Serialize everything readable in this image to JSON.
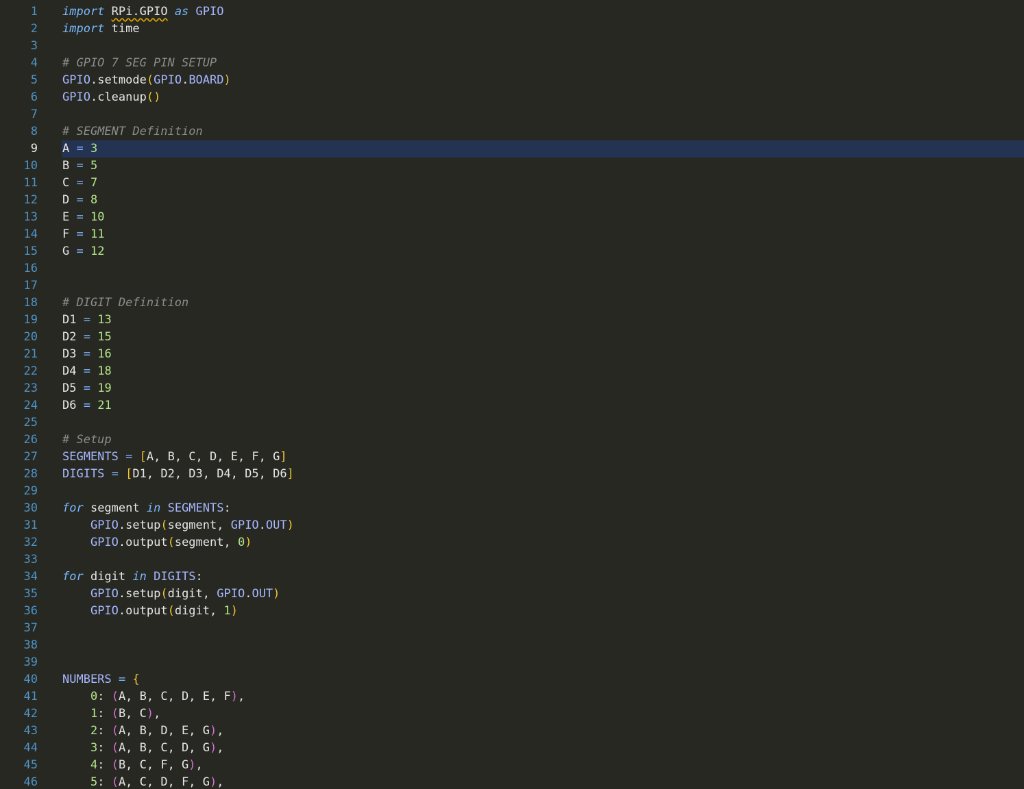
{
  "editor": {
    "language": "python",
    "current_line": 9,
    "colors": {
      "background": "#272822",
      "line_number": "#4e93c7",
      "current_line_highlight": "#243352",
      "keyword": "#79b8ff",
      "identifier": "#e6e6e6",
      "module_name": "#a6b8ff",
      "comment": "#8c8c8c",
      "number": "#b6e68a",
      "bracket": "#f0c832",
      "inner_paren": "#d670d6",
      "warning_squiggle": "#d9a400"
    },
    "lines": [
      {
        "n": "1",
        "tokens": [
          [
            "kw",
            "import"
          ],
          [
            "ident",
            " "
          ],
          [
            "squiggle",
            "RPi.GPIO"
          ],
          [
            "ident",
            " "
          ],
          [
            "kw",
            "as"
          ],
          [
            "ident",
            " "
          ],
          [
            "mod",
            "GPIO"
          ]
        ]
      },
      {
        "n": "2",
        "tokens": [
          [
            "kw",
            "import"
          ],
          [
            "ident",
            " time"
          ]
        ]
      },
      {
        "n": "3",
        "tokens": []
      },
      {
        "n": "4",
        "tokens": [
          [
            "comment",
            "# GPIO 7 SEG PIN SETUP"
          ]
        ]
      },
      {
        "n": "5",
        "tokens": [
          [
            "mod",
            "GPIO"
          ],
          [
            "punc",
            "."
          ],
          [
            "ident",
            "setmode"
          ],
          [
            "paren",
            "("
          ],
          [
            "mod",
            "GPIO"
          ],
          [
            "punc",
            "."
          ],
          [
            "mod",
            "BOARD"
          ],
          [
            "paren",
            ")"
          ]
        ]
      },
      {
        "n": "6",
        "tokens": [
          [
            "mod",
            "GPIO"
          ],
          [
            "punc",
            "."
          ],
          [
            "ident",
            "cleanup"
          ],
          [
            "paren",
            "()"
          ]
        ]
      },
      {
        "n": "7",
        "tokens": []
      },
      {
        "n": "8",
        "tokens": [
          [
            "comment",
            "# SEGMENT Definition"
          ]
        ]
      },
      {
        "n": "9",
        "tokens": [
          [
            "ident",
            "A "
          ],
          [
            "op",
            "="
          ],
          [
            "ident",
            " "
          ],
          [
            "num",
            "3"
          ]
        ]
      },
      {
        "n": "10",
        "tokens": [
          [
            "ident",
            "B "
          ],
          [
            "op",
            "="
          ],
          [
            "ident",
            " "
          ],
          [
            "num",
            "5"
          ]
        ]
      },
      {
        "n": "11",
        "tokens": [
          [
            "ident",
            "C "
          ],
          [
            "op",
            "="
          ],
          [
            "ident",
            " "
          ],
          [
            "num",
            "7"
          ]
        ]
      },
      {
        "n": "12",
        "tokens": [
          [
            "ident",
            "D "
          ],
          [
            "op",
            "="
          ],
          [
            "ident",
            " "
          ],
          [
            "num",
            "8"
          ]
        ]
      },
      {
        "n": "13",
        "tokens": [
          [
            "ident",
            "E "
          ],
          [
            "op",
            "="
          ],
          [
            "ident",
            " "
          ],
          [
            "num",
            "10"
          ]
        ]
      },
      {
        "n": "14",
        "tokens": [
          [
            "ident",
            "F "
          ],
          [
            "op",
            "="
          ],
          [
            "ident",
            " "
          ],
          [
            "num",
            "11"
          ]
        ]
      },
      {
        "n": "15",
        "tokens": [
          [
            "ident",
            "G "
          ],
          [
            "op",
            "="
          ],
          [
            "ident",
            " "
          ],
          [
            "num",
            "12"
          ]
        ]
      },
      {
        "n": "16",
        "tokens": []
      },
      {
        "n": "17",
        "tokens": []
      },
      {
        "n": "18",
        "tokens": [
          [
            "comment",
            "# DIGIT Definition"
          ]
        ]
      },
      {
        "n": "19",
        "tokens": [
          [
            "ident",
            "D1 "
          ],
          [
            "op",
            "="
          ],
          [
            "ident",
            " "
          ],
          [
            "num",
            "13"
          ]
        ]
      },
      {
        "n": "20",
        "tokens": [
          [
            "ident",
            "D2 "
          ],
          [
            "op",
            "="
          ],
          [
            "ident",
            " "
          ],
          [
            "num",
            "15"
          ]
        ]
      },
      {
        "n": "21",
        "tokens": [
          [
            "ident",
            "D3 "
          ],
          [
            "op",
            "="
          ],
          [
            "ident",
            " "
          ],
          [
            "num",
            "16"
          ]
        ]
      },
      {
        "n": "22",
        "tokens": [
          [
            "ident",
            "D4 "
          ],
          [
            "op",
            "="
          ],
          [
            "ident",
            " "
          ],
          [
            "num",
            "18"
          ]
        ]
      },
      {
        "n": "23",
        "tokens": [
          [
            "ident",
            "D5 "
          ],
          [
            "op",
            "="
          ],
          [
            "ident",
            " "
          ],
          [
            "num",
            "19"
          ]
        ]
      },
      {
        "n": "24",
        "tokens": [
          [
            "ident",
            "D6 "
          ],
          [
            "op",
            "="
          ],
          [
            "ident",
            " "
          ],
          [
            "num",
            "21"
          ]
        ]
      },
      {
        "n": "25",
        "tokens": []
      },
      {
        "n": "26",
        "tokens": [
          [
            "comment",
            "# Setup"
          ]
        ]
      },
      {
        "n": "27",
        "tokens": [
          [
            "mod",
            "SEGMENTS"
          ],
          [
            "ident",
            " "
          ],
          [
            "op",
            "="
          ],
          [
            "ident",
            " "
          ],
          [
            "bracket",
            "["
          ],
          [
            "ident",
            "A, B, C, D, E, F, G"
          ],
          [
            "bracket",
            "]"
          ]
        ]
      },
      {
        "n": "28",
        "tokens": [
          [
            "mod",
            "DIGITS"
          ],
          [
            "ident",
            " "
          ],
          [
            "op",
            "="
          ],
          [
            "ident",
            " "
          ],
          [
            "bracket",
            "["
          ],
          [
            "ident",
            "D1, D2, D3, D4, D5, D6"
          ],
          [
            "bracket",
            "]"
          ]
        ]
      },
      {
        "n": "29",
        "tokens": []
      },
      {
        "n": "30",
        "tokens": [
          [
            "kw",
            "for"
          ],
          [
            "ident",
            " segment "
          ],
          [
            "kw",
            "in"
          ],
          [
            "ident",
            " "
          ],
          [
            "mod",
            "SEGMENTS"
          ],
          [
            "punc",
            ":"
          ]
        ]
      },
      {
        "n": "31",
        "tokens": [
          [
            "ident",
            "    "
          ],
          [
            "mod",
            "GPIO"
          ],
          [
            "punc",
            "."
          ],
          [
            "ident",
            "setup"
          ],
          [
            "paren",
            "("
          ],
          [
            "ident",
            "segment, "
          ],
          [
            "mod",
            "GPIO"
          ],
          [
            "punc",
            "."
          ],
          [
            "mod",
            "OUT"
          ],
          [
            "paren",
            ")"
          ]
        ]
      },
      {
        "n": "32",
        "tokens": [
          [
            "ident",
            "    "
          ],
          [
            "mod",
            "GPIO"
          ],
          [
            "punc",
            "."
          ],
          [
            "ident",
            "output"
          ],
          [
            "paren",
            "("
          ],
          [
            "ident",
            "segment, "
          ],
          [
            "num",
            "0"
          ],
          [
            "paren",
            ")"
          ]
        ]
      },
      {
        "n": "33",
        "tokens": []
      },
      {
        "n": "34",
        "tokens": [
          [
            "kw",
            "for"
          ],
          [
            "ident",
            " digit "
          ],
          [
            "kw",
            "in"
          ],
          [
            "ident",
            " "
          ],
          [
            "mod",
            "DIGITS"
          ],
          [
            "punc",
            ":"
          ]
        ]
      },
      {
        "n": "35",
        "tokens": [
          [
            "ident",
            "    "
          ],
          [
            "mod",
            "GPIO"
          ],
          [
            "punc",
            "."
          ],
          [
            "ident",
            "setup"
          ],
          [
            "paren",
            "("
          ],
          [
            "ident",
            "digit, "
          ],
          [
            "mod",
            "GPIO"
          ],
          [
            "punc",
            "."
          ],
          [
            "mod",
            "OUT"
          ],
          [
            "paren",
            ")"
          ]
        ]
      },
      {
        "n": "36",
        "tokens": [
          [
            "ident",
            "    "
          ],
          [
            "mod",
            "GPIO"
          ],
          [
            "punc",
            "."
          ],
          [
            "ident",
            "output"
          ],
          [
            "paren",
            "("
          ],
          [
            "ident",
            "digit, "
          ],
          [
            "num",
            "1"
          ],
          [
            "paren",
            ")"
          ]
        ]
      },
      {
        "n": "37",
        "tokens": []
      },
      {
        "n": "38",
        "tokens": []
      },
      {
        "n": "39",
        "tokens": []
      },
      {
        "n": "40",
        "tokens": [
          [
            "mod",
            "NUMBERS"
          ],
          [
            "ident",
            " "
          ],
          [
            "op",
            "="
          ],
          [
            "ident",
            " "
          ],
          [
            "brace",
            "{"
          ]
        ]
      },
      {
        "n": "41",
        "tokens": [
          [
            "ident",
            "    "
          ],
          [
            "num",
            "0"
          ],
          [
            "punc",
            ": "
          ],
          [
            "paren2",
            "("
          ],
          [
            "ident",
            "A, B, C, D, E, F"
          ],
          [
            "paren2",
            ")"
          ],
          [
            "punc",
            ","
          ]
        ]
      },
      {
        "n": "42",
        "tokens": [
          [
            "ident",
            "    "
          ],
          [
            "num",
            "1"
          ],
          [
            "punc",
            ": "
          ],
          [
            "paren2",
            "("
          ],
          [
            "ident",
            "B, C"
          ],
          [
            "paren2",
            ")"
          ],
          [
            "punc",
            ","
          ]
        ]
      },
      {
        "n": "43",
        "tokens": [
          [
            "ident",
            "    "
          ],
          [
            "num",
            "2"
          ],
          [
            "punc",
            ": "
          ],
          [
            "paren2",
            "("
          ],
          [
            "ident",
            "A, B, D, E, G"
          ],
          [
            "paren2",
            ")"
          ],
          [
            "punc",
            ","
          ]
        ]
      },
      {
        "n": "44",
        "tokens": [
          [
            "ident",
            "    "
          ],
          [
            "num",
            "3"
          ],
          [
            "punc",
            ": "
          ],
          [
            "paren2",
            "("
          ],
          [
            "ident",
            "A, B, C, D, G"
          ],
          [
            "paren2",
            ")"
          ],
          [
            "punc",
            ","
          ]
        ]
      },
      {
        "n": "45",
        "tokens": [
          [
            "ident",
            "    "
          ],
          [
            "num",
            "4"
          ],
          [
            "punc",
            ": "
          ],
          [
            "paren2",
            "("
          ],
          [
            "ident",
            "B, C, F, G"
          ],
          [
            "paren2",
            ")"
          ],
          [
            "punc",
            ","
          ]
        ]
      },
      {
        "n": "46",
        "tokens": [
          [
            "ident",
            "    "
          ],
          [
            "num",
            "5"
          ],
          [
            "punc",
            ": "
          ],
          [
            "paren2",
            "("
          ],
          [
            "ident",
            "A, C, D, F, G"
          ],
          [
            "paren2",
            ")"
          ],
          [
            "punc",
            ","
          ]
        ]
      }
    ]
  }
}
